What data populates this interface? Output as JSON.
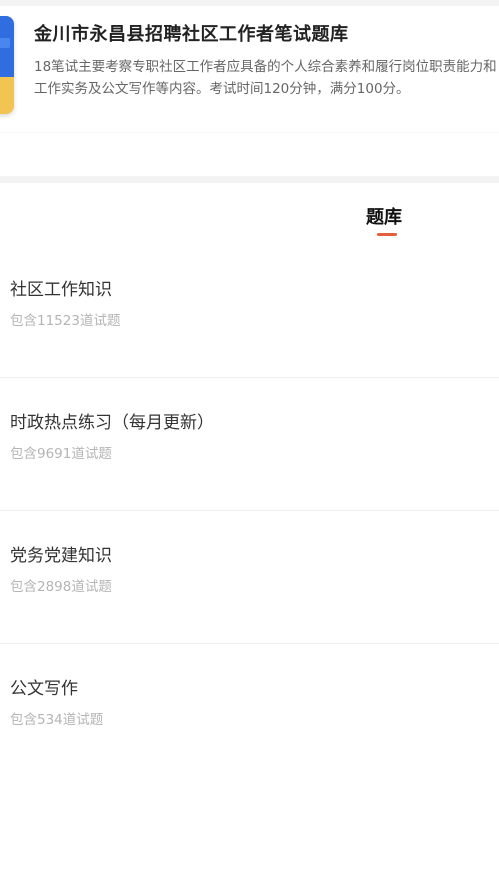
{
  "header": {
    "title": "金川市永昌县招聘社区工作者笔试题库",
    "description": "18笔试主要考察专职社区工作者应具备的个人综合素养和履行岗位职责能力和工作实务及公文写作等内容。考试时间120分钟，满分100分。",
    "cover_icon": "book-cover-icon"
  },
  "tabs": {
    "active_label": "题库",
    "accent_color": "#e5603a"
  },
  "banks": [
    {
      "name": "社区工作知识",
      "count": "包含11523道试题"
    },
    {
      "name": "时政热点练习（每月更新）",
      "count": "包含9691道试题"
    },
    {
      "name": "党务党建知识",
      "count": "包含2898道试题"
    },
    {
      "name": "公文写作",
      "count": "包含534道试题"
    }
  ]
}
